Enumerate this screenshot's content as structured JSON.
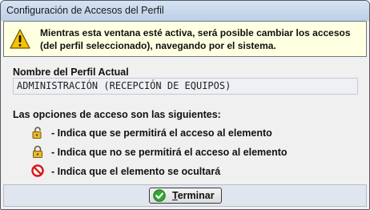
{
  "window": {
    "title": "Configuración de Accesos del Perfil"
  },
  "notice": {
    "icon": "warning-icon",
    "text": "Mientras esta ventana esté activa, será posible cambiar los accesos (del perfil seleccionado), navegando por el sistema."
  },
  "profile": {
    "label": "Nombre del Perfil Actual",
    "value": "ADMINISTRACIÓN (RECEPCIÓN DE EQUIPOS)"
  },
  "legend": {
    "heading": "Las opciones de acceso son las siguientes:",
    "items": [
      {
        "icon": "unlocked-icon",
        "text": "- Indica que se permitirá el acceso al elemento"
      },
      {
        "icon": "locked-icon",
        "text": "- Indica que no se permitirá el acceso al elemento"
      },
      {
        "icon": "hidden-icon",
        "text": "- Indica que el elemento se ocultará"
      }
    ]
  },
  "footer": {
    "button_first_letter": "T",
    "button_rest": "erminar",
    "button_icon": "check-icon"
  }
}
